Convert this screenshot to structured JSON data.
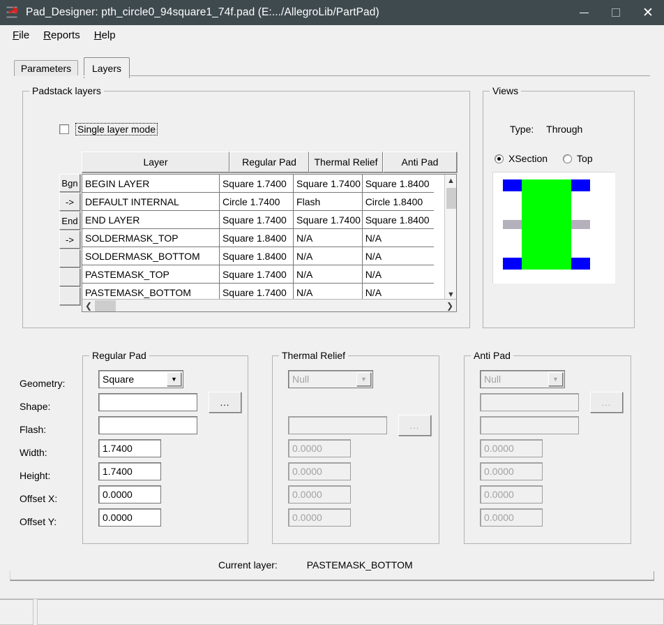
{
  "window": {
    "title": "Pad_Designer: pth_circle0_94square1_74f.pad (E:.../AllegroLib/PartPad)",
    "icon": "padstack-icon",
    "minimize": "minimize-icon",
    "maximize": "maximize-icon",
    "close": "close-icon",
    "titlebar_color": "#3f4a4f"
  },
  "menubar": {
    "items": [
      {
        "label": "File",
        "mnemonic": "F"
      },
      {
        "label": "Reports",
        "mnemonic": "R"
      },
      {
        "label": "Help",
        "mnemonic": "H"
      }
    ]
  },
  "tabs": [
    {
      "label": "Parameters",
      "active": false
    },
    {
      "label": "Layers",
      "active": true
    }
  ],
  "padstack_group": {
    "legend": "Padstack layers",
    "single_layer_mode": {
      "label": "Single layer mode",
      "checked": false
    },
    "columns": [
      "Layer",
      "Regular Pad",
      "Thermal Relief",
      "Anti Pad"
    ],
    "row_buttons": [
      "Bgn",
      "->",
      "End",
      "->",
      "",
      "",
      ""
    ],
    "rows": [
      {
        "layer": "BEGIN LAYER",
        "regular": "Square 1.7400",
        "thermal": "Square 1.7400",
        "anti": "Square 1.8400"
      },
      {
        "layer": "DEFAULT INTERNAL",
        "regular": "Circle 1.7400",
        "thermal": "Flash",
        "anti": "Circle 1.8400"
      },
      {
        "layer": "END LAYER",
        "regular": "Square 1.7400",
        "thermal": "Square 1.7400",
        "anti": "Square 1.8400"
      },
      {
        "layer": "SOLDERMASK_TOP",
        "regular": "Square 1.8400",
        "thermal": "N/A",
        "anti": "N/A"
      },
      {
        "layer": "SOLDERMASK_BOTTOM",
        "regular": "Square 1.8400",
        "thermal": "N/A",
        "anti": "N/A"
      },
      {
        "layer": "PASTEMASK_TOP",
        "regular": "Square 1.7400",
        "thermal": "N/A",
        "anti": "N/A"
      },
      {
        "layer": "PASTEMASK_BOTTOM",
        "regular": "Square 1.7400",
        "thermal": "N/A",
        "anti": "N/A"
      }
    ],
    "scroll_up_icon": "chevron-up-icon",
    "scroll_down_icon": "chevron-down-icon",
    "scroll_left_icon": "chevron-left-icon",
    "scroll_right_icon": "chevron-right-icon"
  },
  "views_group": {
    "legend": "Views",
    "type_label": "Type:",
    "type_value": "Through",
    "xsection_label": "XSection",
    "top_label": "Top",
    "selected_view": "XSection",
    "preview": {
      "pad_color": "#0000ff",
      "drill_color": "#00ff00",
      "internal_color": "#b4b0bc",
      "background_color": "#ffffff"
    }
  },
  "param_labels": [
    "Geometry:",
    "Shape:",
    "Flash:",
    "Width:",
    "Height:",
    "Offset X:",
    "Offset Y:"
  ],
  "regular_pad": {
    "legend": "Regular Pad",
    "geometry": "Square",
    "shape": "",
    "flash": "",
    "width": "1.7400",
    "height": "1.7400",
    "offset_x": "0.0000",
    "offset_y": "0.0000",
    "browse_label": "...",
    "enabled": true
  },
  "thermal_relief": {
    "legend": "Thermal Relief",
    "geometry": "Null",
    "flash": "",
    "width": "0.0000",
    "height": "0.0000",
    "offset_x": "0.0000",
    "offset_y": "0.0000",
    "browse_label": "...",
    "enabled": false
  },
  "anti_pad": {
    "legend": "Anti Pad",
    "geometry": "Null",
    "shape": "",
    "flash": "",
    "width": "0.0000",
    "height": "0.0000",
    "offset_x": "0.0000",
    "offset_y": "0.0000",
    "browse_label": "...",
    "enabled": false
  },
  "current_layer": {
    "label": "Current layer:",
    "value": "PASTEMASK_BOTTOM"
  },
  "statusbar": {
    "left_pane": "",
    "right_pane": ""
  }
}
